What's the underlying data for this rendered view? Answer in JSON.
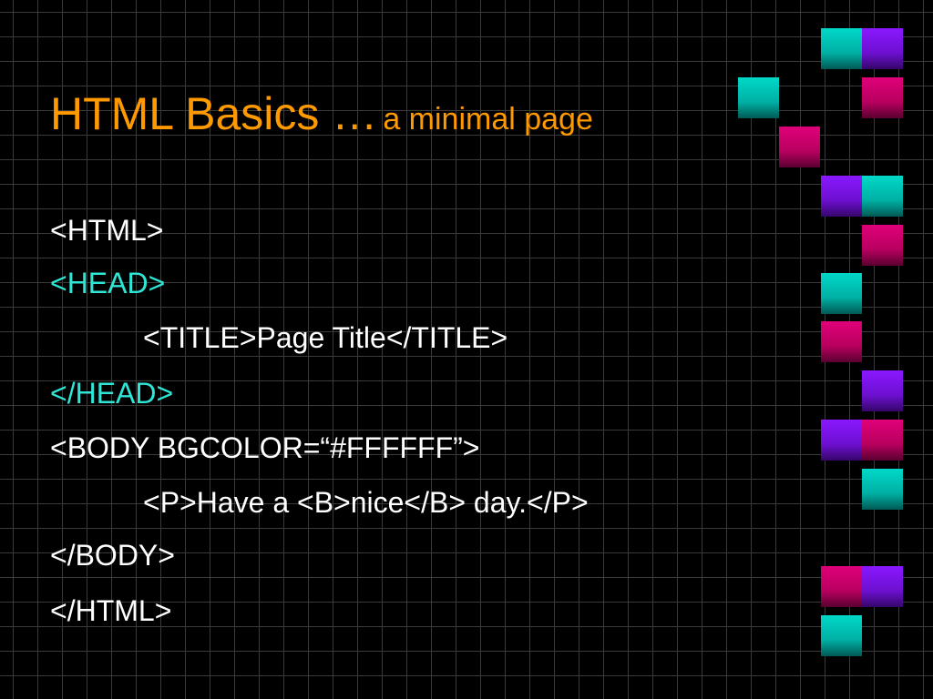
{
  "slide": {
    "title_main": "HTML Basics …",
    "title_sub": "a minimal page",
    "code_lines": [
      "<HTML>",
      "<HEAD>",
      "<TITLE>Page Title</TITLE>",
      "</HEAD>",
      "<BODY BGCOLOR=“#FFFFFF”>",
      "<P>Have a <B>nice</B> day.</P>",
      "</BODY>",
      "</HTML>"
    ]
  },
  "colors": {
    "background": "#000000",
    "grid": "#3a3a3a",
    "title": "#ff9900",
    "code_text": "#ffffff",
    "head_tags": "#2ee6d6",
    "tile_cyan": "#00d8c8",
    "tile_purple": "#8a18ff",
    "tile_magenta": "#e0007a"
  }
}
